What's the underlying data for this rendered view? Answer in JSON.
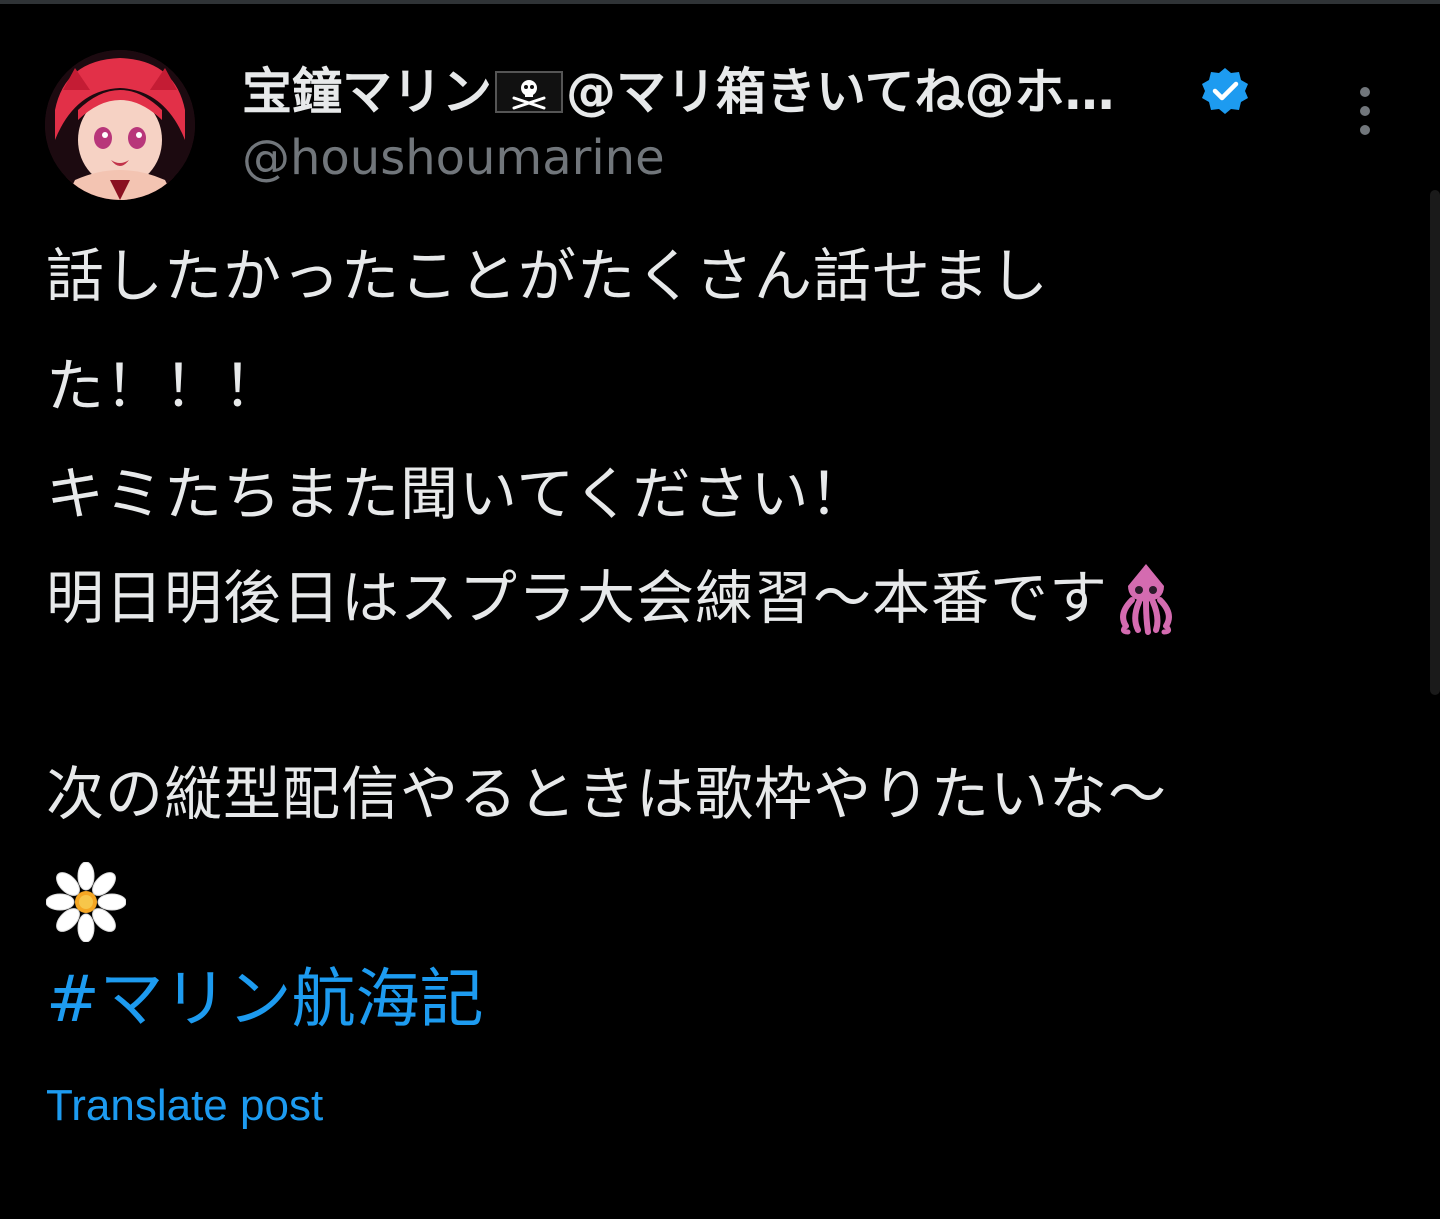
{
  "post": {
    "author": {
      "display_name_part1": "宝鐘マリン",
      "display_name_part2": "@マリ箱きいてね@ホ…",
      "flag_icon": "pirate-flag-icon",
      "handle": "@houshoumarine",
      "verified": true,
      "verified_color": "#1d9bf0"
    },
    "body": {
      "line1": "話したかったことがたくさん話せまし",
      "line2": "た！！！",
      "line3": "キミたちまた聞いてください！",
      "line4": "明日明後日はスプラ大会練習〜本番です",
      "line4_emoji": "squid-emoji",
      "line5": "次の縦型配信やるときは歌枠やりたいな〜",
      "line6_emoji": "daisy-emoji"
    },
    "hashtag": "#マリン航海記",
    "translate_label": "Translate post"
  },
  "colors": {
    "background": "#000000",
    "text": "#e7e9ea",
    "muted": "#71767b",
    "link": "#1d9bf0"
  }
}
